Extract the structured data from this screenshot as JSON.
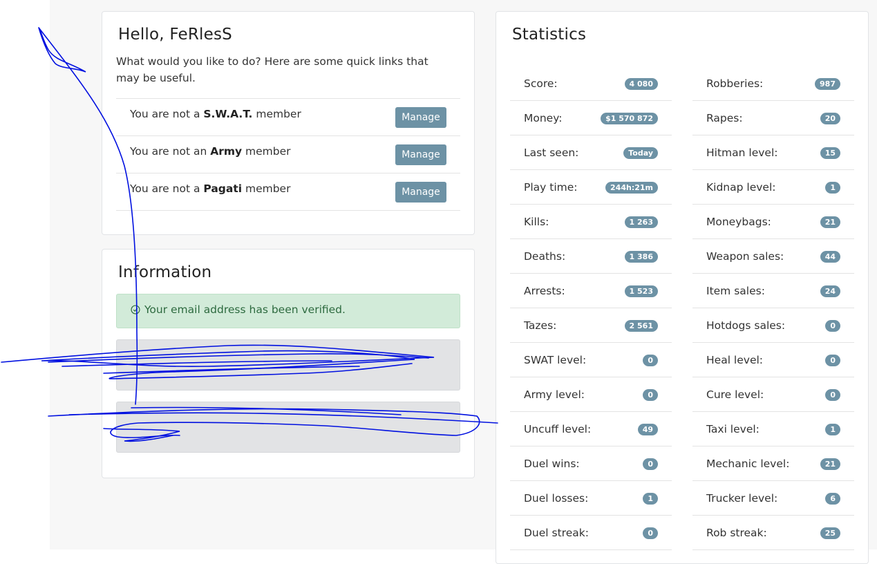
{
  "welcome": {
    "greeting": "Hello, FeRlesS",
    "description": "What would you like to do? Here are some quick links that may be useful.",
    "memberships": [
      {
        "prefix": "You are not a ",
        "group": "S.W.A.T.",
        "suffix": " member",
        "button": "Manage"
      },
      {
        "prefix": "You are not an ",
        "group": "Army",
        "suffix": " member",
        "button": "Manage"
      },
      {
        "prefix": "You are not a ",
        "group": "Pagati",
        "suffix": " member",
        "button": "Manage"
      }
    ]
  },
  "information": {
    "title": "Information",
    "verified_message": "Your email address has been verified.",
    "icon": "check-circle-icon"
  },
  "statistics": {
    "title": "Statistics",
    "left": [
      {
        "label": "Score:",
        "value": "4 080"
      },
      {
        "label": "Money:",
        "value": "$1 570 872"
      },
      {
        "label": "Last seen:",
        "value": "Today"
      },
      {
        "label": "Play time:",
        "value": "244h:21m"
      },
      {
        "label": "Kills:",
        "value": "1 263"
      },
      {
        "label": "Deaths:",
        "value": "1 386"
      },
      {
        "label": "Arrests:",
        "value": "1 523"
      },
      {
        "label": "Tazes:",
        "value": "2 561"
      },
      {
        "label": "SWAT level:",
        "value": "0"
      },
      {
        "label": "Army level:",
        "value": "0"
      },
      {
        "label": "Uncuff level:",
        "value": "49"
      },
      {
        "label": "Duel wins:",
        "value": "0"
      },
      {
        "label": "Duel losses:",
        "value": "1"
      },
      {
        "label": "Duel streak:",
        "value": "0"
      }
    ],
    "right": [
      {
        "label": "Robberies:",
        "value": "987"
      },
      {
        "label": "Rapes:",
        "value": "20"
      },
      {
        "label": "Hitman level:",
        "value": "15"
      },
      {
        "label": "Kidnap level:",
        "value": "1"
      },
      {
        "label": "Moneybags:",
        "value": "21"
      },
      {
        "label": "Weapon sales:",
        "value": "44"
      },
      {
        "label": "Item sales:",
        "value": "24"
      },
      {
        "label": "Hotdogs sales:",
        "value": "0"
      },
      {
        "label": "Heal level:",
        "value": "0"
      },
      {
        "label": "Cure level:",
        "value": "0"
      },
      {
        "label": "Taxi level:",
        "value": "1"
      },
      {
        "label": "Mechanic level:",
        "value": "21"
      },
      {
        "label": "Trucker level:",
        "value": "6"
      },
      {
        "label": "Rob streak:",
        "value": "25"
      }
    ]
  },
  "colors": {
    "badge": "#6d92a5",
    "success_bg": "#d2ebd9",
    "scribble": "#0010e0"
  }
}
